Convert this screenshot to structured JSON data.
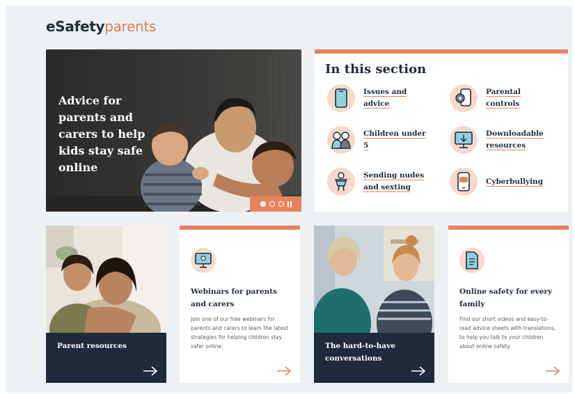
{
  "brand": {
    "part1": "eSafety",
    "part2": "parents"
  },
  "hero": {
    "title": "Advice for parents and carers to help kids stay safe online",
    "carousel_slides": 3,
    "active_slide": 1
  },
  "section": {
    "title": "In this section",
    "items": [
      {
        "label": "Issues and advice",
        "icon": "phone-icon"
      },
      {
        "label": "Parental controls",
        "icon": "phone-settings-icon"
      },
      {
        "label": "Children under 5",
        "icon": "children-icon"
      },
      {
        "label": "Downloadable resources",
        "icon": "monitor-icon"
      },
      {
        "label": "Sending nudes and sexting",
        "icon": "person-icon"
      },
      {
        "label": "Cyberbullying",
        "icon": "phone-message-icon"
      }
    ]
  },
  "cards": [
    {
      "type": "photo",
      "title": "Parent resources"
    },
    {
      "type": "text",
      "title": "Webinars for parents and carers",
      "body": "Join one of our free webinars for parents and carers to learn the latest strategies for helping children stay safer online.",
      "icon": "webinar-icon"
    },
    {
      "type": "photo",
      "title": "The hard-to-have conversations"
    },
    {
      "type": "text",
      "title": "Online safety for every family",
      "body": "Find our short videos and easy-to-read advice sheets with translations, to help you talk to your children about online safety.",
      "icon": "document-icon"
    }
  ],
  "colors": {
    "accent": "#e8825e",
    "navy": "#1f2b3a",
    "icon_bg": "#f6d9cc",
    "page_bg": "#eef1f4"
  }
}
